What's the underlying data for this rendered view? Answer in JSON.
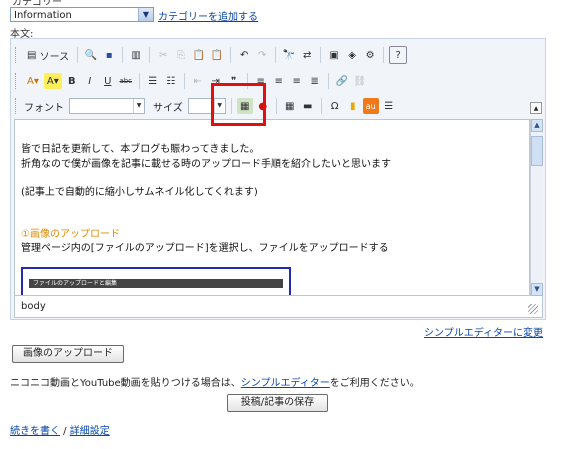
{
  "category": {
    "label_cut": "カテゴリー",
    "selected": "Information",
    "add_link": "カテゴリーを追加する"
  },
  "body_label": "本文:",
  "toolbar": {
    "source_label": "ソース",
    "bold": "B",
    "italic": "I",
    "underline": "U",
    "strike": "abc",
    "font_label": "フォント",
    "size_label": "サイズ",
    "omega": "Ω",
    "au": "au"
  },
  "content": {
    "line1": "皆で日記を更新して、本ブログも賑わってきました。",
    "line2": "折角なので僕が画像を記事に載せる時のアップロード手順を紹介したいと思います",
    "line3": "(記事上で自動的に縮小しサムネイル化してくれます)",
    "line4": "①画像のアップロード",
    "line5": "管理ページ内の[ファイルのアップロード]を選択し、ファイルをアップロードする",
    "thumb_bar": "ファイルのアップロードと編集"
  },
  "statusbar_text": "body",
  "simple_editor_link": "シンプルエディターに変更",
  "upload_button": "画像のアップロード",
  "nico_note": {
    "before": "ニコニコ動画とYouTube動画を貼りつける場合は、",
    "link": "シンプルエディター",
    "after": "をご利用ください。"
  },
  "save_button": "投稿/記事の保存",
  "bottom_links": {
    "continue": "続きを書く",
    "separator": " / ",
    "details": "詳細設定"
  },
  "colors": {
    "highlight": "#e01010",
    "link": "#0645ad",
    "orange_text": "#e08a00"
  }
}
